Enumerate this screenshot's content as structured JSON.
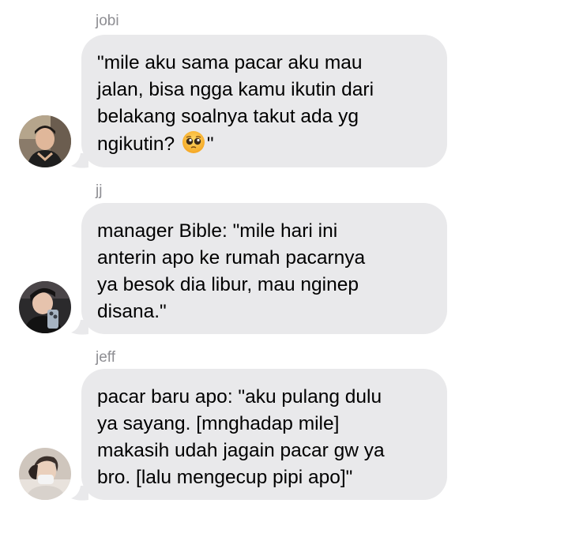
{
  "messages": [
    {
      "sender": "jobi",
      "lines": [
        "\"mile aku sama pacar aku mau",
        "jalan, bisa ngga kamu ikutin dari",
        "belakang soalnya takut ada yg",
        "ngikutin? ",
        "\""
      ],
      "emoji": "pleading-face-emoji",
      "avatar": "avatar-jobi"
    },
    {
      "sender": "jj",
      "lines": [
        "manager Bible: \"mile hari ini",
        "anterin apo ke rumah pacarnya",
        "ya besok dia libur, mau nginep",
        "disana.\""
      ],
      "avatar": "avatar-jj"
    },
    {
      "sender": "jeff",
      "lines": [
        "pacar baru apo: \"aku pulang dulu",
        "ya sayang. [mnghadap mile]",
        "makasih udah jagain pacar gw ya",
        "bro. [lalu mengecup pipi apo]\""
      ],
      "avatar": "avatar-jeff"
    }
  ],
  "colors": {
    "bubble": "#e9e9eb",
    "sender": "#8e8e93",
    "text": "#000000",
    "background": "#ffffff"
  }
}
